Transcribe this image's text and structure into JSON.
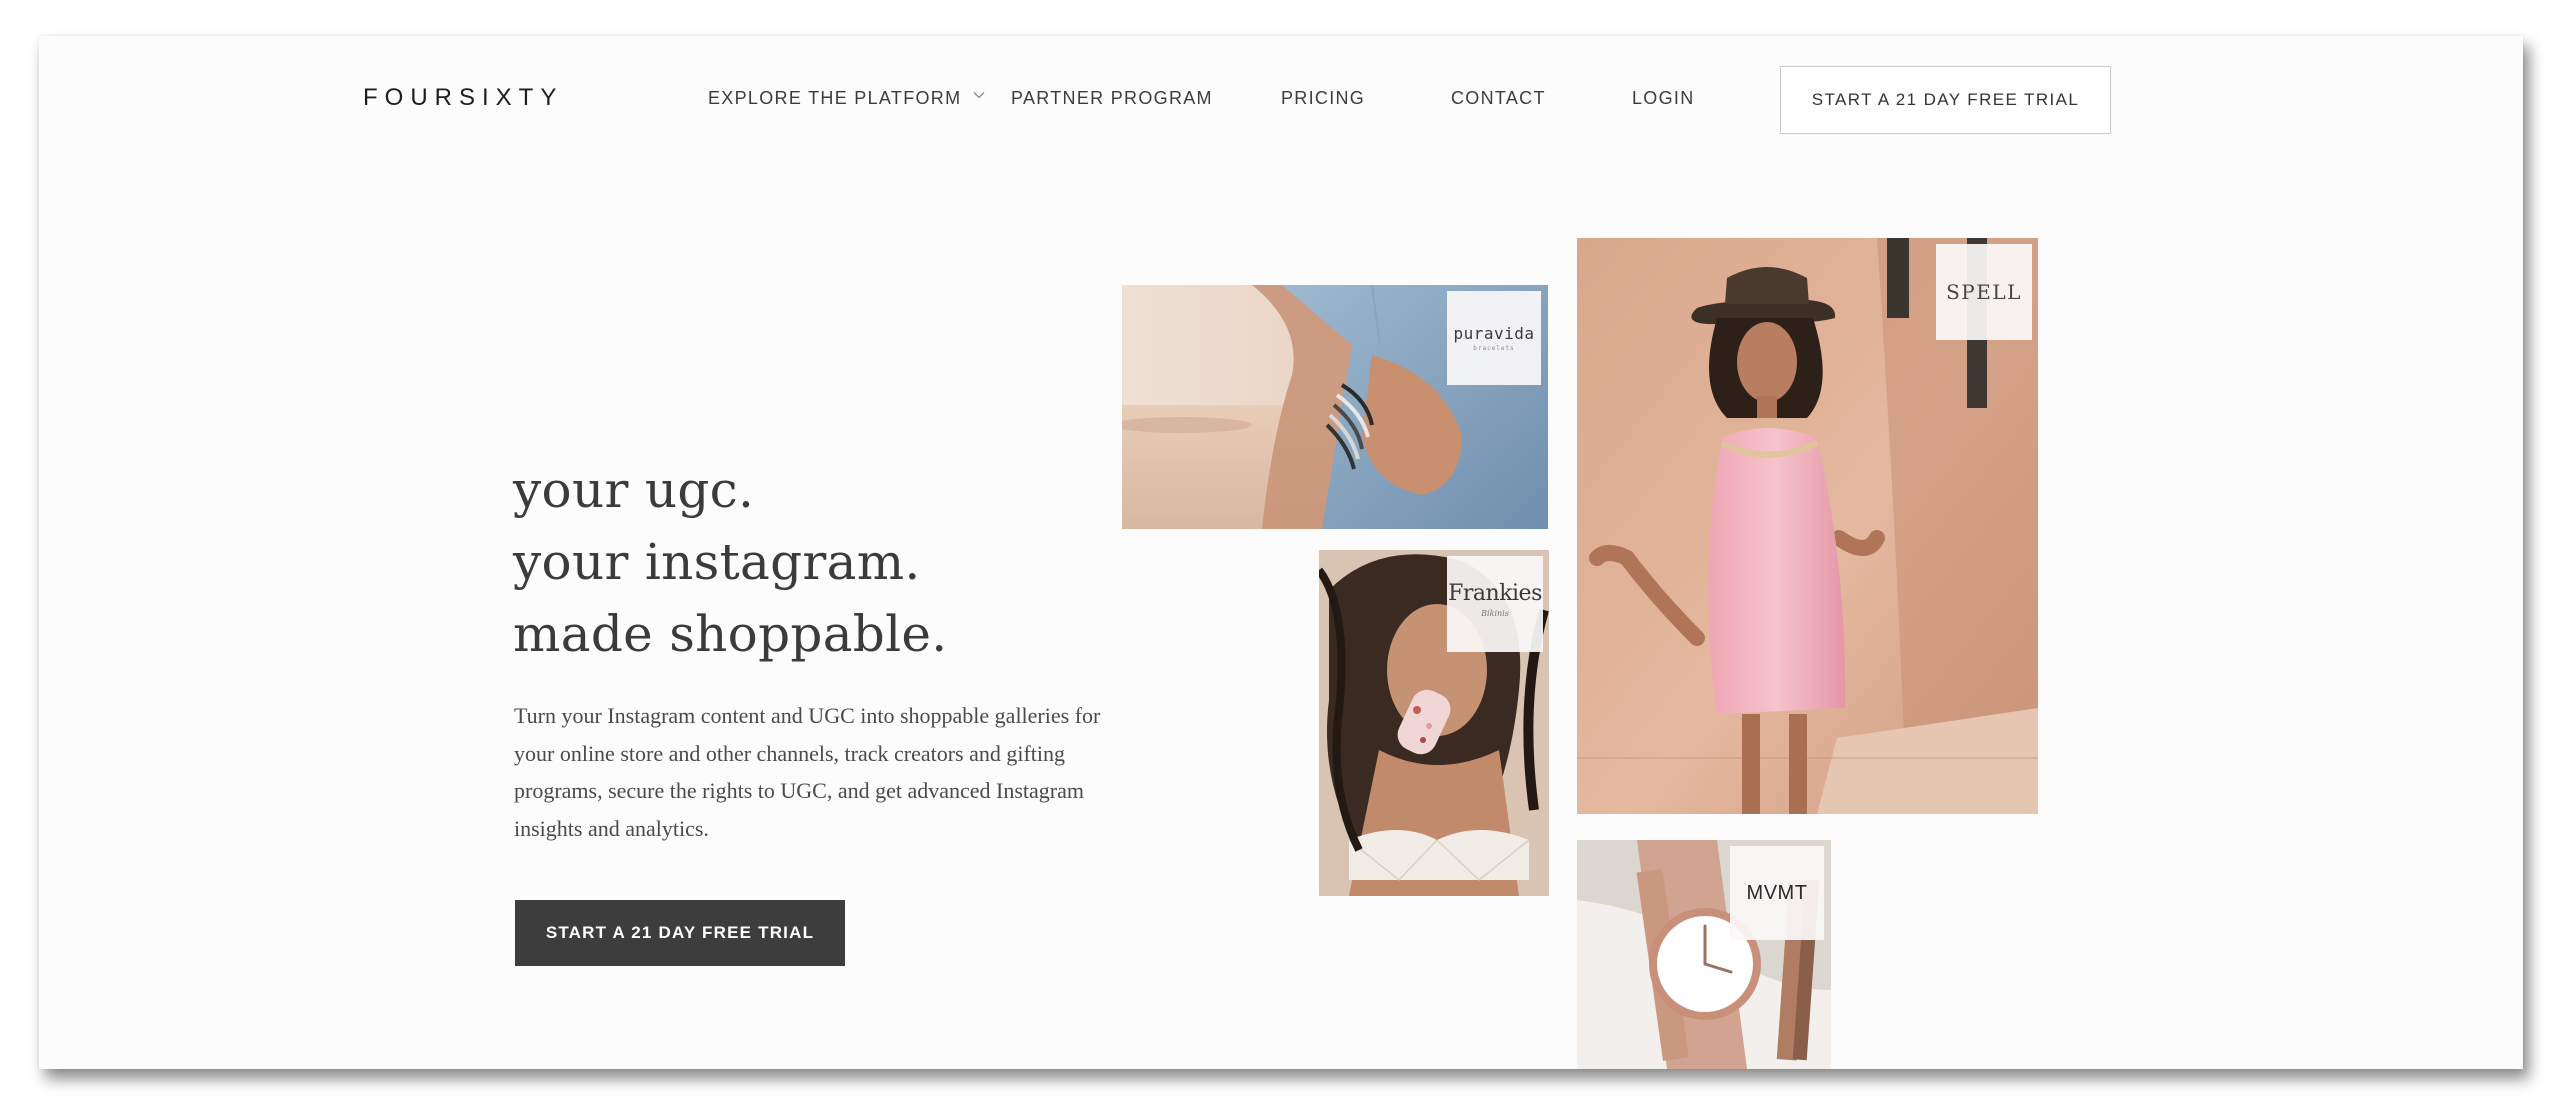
{
  "header": {
    "logo": "FOURSIXTY",
    "nav": [
      {
        "label": "EXPLORE THE PLATFORM",
        "has_dropdown": true
      },
      {
        "label": "PARTNER PROGRAM"
      },
      {
        "label": "PRICING"
      },
      {
        "label": "CONTACT"
      },
      {
        "label": "LOGIN"
      }
    ],
    "cta_label": "START A 21 DAY FREE TRIAL"
  },
  "hero": {
    "headline": [
      "your ugc.",
      "your instagram.",
      "made shoppable."
    ],
    "subcopy": "Turn your Instagram content and UGC into shoppable galleries for your online store and other channels, track creators and gifting programs, secure the rights to UGC, and get advanced Instagram insights and analytics.",
    "cta_label": "START A 21 DAY FREE TRIAL"
  },
  "gallery": [
    {
      "brand": "puravida",
      "brand_sub": "bracelets",
      "icon": "bracelets-photo"
    },
    {
      "brand": "Frankies",
      "brand_sub": "Bikinis",
      "icon": "woman-popsicle-photo"
    },
    {
      "brand": "SPELL",
      "icon": "woman-pink-dress-photo"
    },
    {
      "brand": "MVMT",
      "icon": "wristwatch-photo"
    }
  ],
  "colors": {
    "page_bg": "#fdfcfc",
    "text_dark": "#3b3b3b",
    "cta_dark": "#3d3d3d",
    "cta_border": "#c9c9c9"
  }
}
